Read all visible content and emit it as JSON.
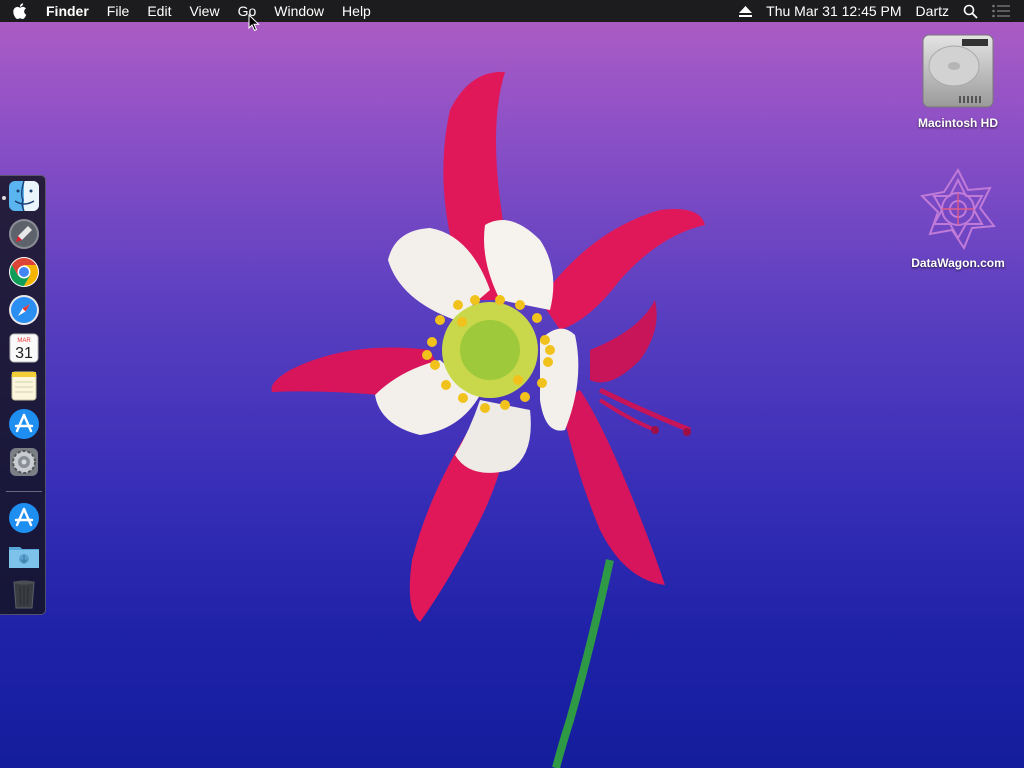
{
  "menubar": {
    "apple_icon": "apple-icon",
    "app_name": "Finder",
    "menus": [
      "File",
      "Edit",
      "View",
      "Go",
      "Window",
      "Help"
    ],
    "clock": "Thu Mar 31  12:45 PM",
    "user": "Dartz",
    "status_icons": [
      "eject-icon",
      "search-icon",
      "notification-center-icon"
    ]
  },
  "desktop": {
    "icons": [
      {
        "label": "Macintosh HD",
        "icon": "hard-drive-icon"
      },
      {
        "label": "DataWagon.com",
        "icon": "disk-image-icon"
      }
    ]
  },
  "dock": {
    "items": [
      {
        "name": "Finder",
        "icon": "finder-icon",
        "running": true
      },
      {
        "name": "Launchpad",
        "icon": "launchpad-icon"
      },
      {
        "name": "Google Chrome",
        "icon": "chrome-icon"
      },
      {
        "name": "Safari",
        "icon": "safari-icon"
      },
      {
        "name": "Calendar",
        "icon": "calendar-icon",
        "badge_month": "MAR",
        "badge_day": "31"
      },
      {
        "name": "Notes",
        "icon": "notes-icon"
      },
      {
        "name": "App Store",
        "icon": "app-store-icon"
      },
      {
        "name": "System Preferences",
        "icon": "system-preferences-icon"
      },
      {
        "name": "Applications",
        "icon": "app-store-icon"
      },
      {
        "name": "Downloads",
        "icon": "downloads-folder-icon"
      },
      {
        "name": "Trash",
        "icon": "trash-icon"
      }
    ]
  },
  "colors": {
    "menubar_bg": "#1c1c1e",
    "wallpaper_top": "#b15ec4",
    "wallpaper_bottom": "#141d9c",
    "petal": "#e8175d",
    "inner_petal": "#f4f1ee"
  }
}
